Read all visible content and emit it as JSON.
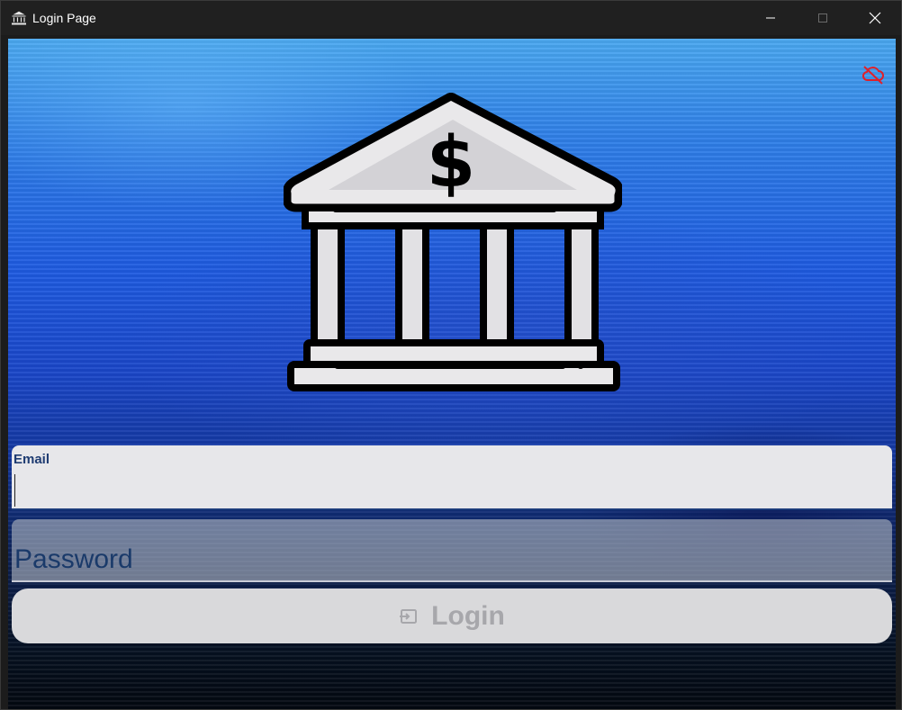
{
  "window": {
    "title": "Login Page",
    "app_icon": "bank-icon",
    "controls": [
      "minimize-icon",
      "maximize-icon",
      "close-icon"
    ]
  },
  "status": {
    "cloud_icon": "cloud-off-icon",
    "cloud_color": "#e0202a"
  },
  "logo": {
    "icon": "bank-dollar-icon",
    "symbol": "$"
  },
  "form": {
    "email": {
      "label": "Email",
      "value": ""
    },
    "password": {
      "placeholder": "Password",
      "value": ""
    },
    "login_button": {
      "label": "Login",
      "icon": "login-icon"
    }
  },
  "colors": {
    "background_top": "#4aa8f0",
    "background_bottom": "#030810",
    "field_label": "#1f3c72",
    "button_bg": "#d9d9db",
    "button_text": "#a7a7ab"
  }
}
